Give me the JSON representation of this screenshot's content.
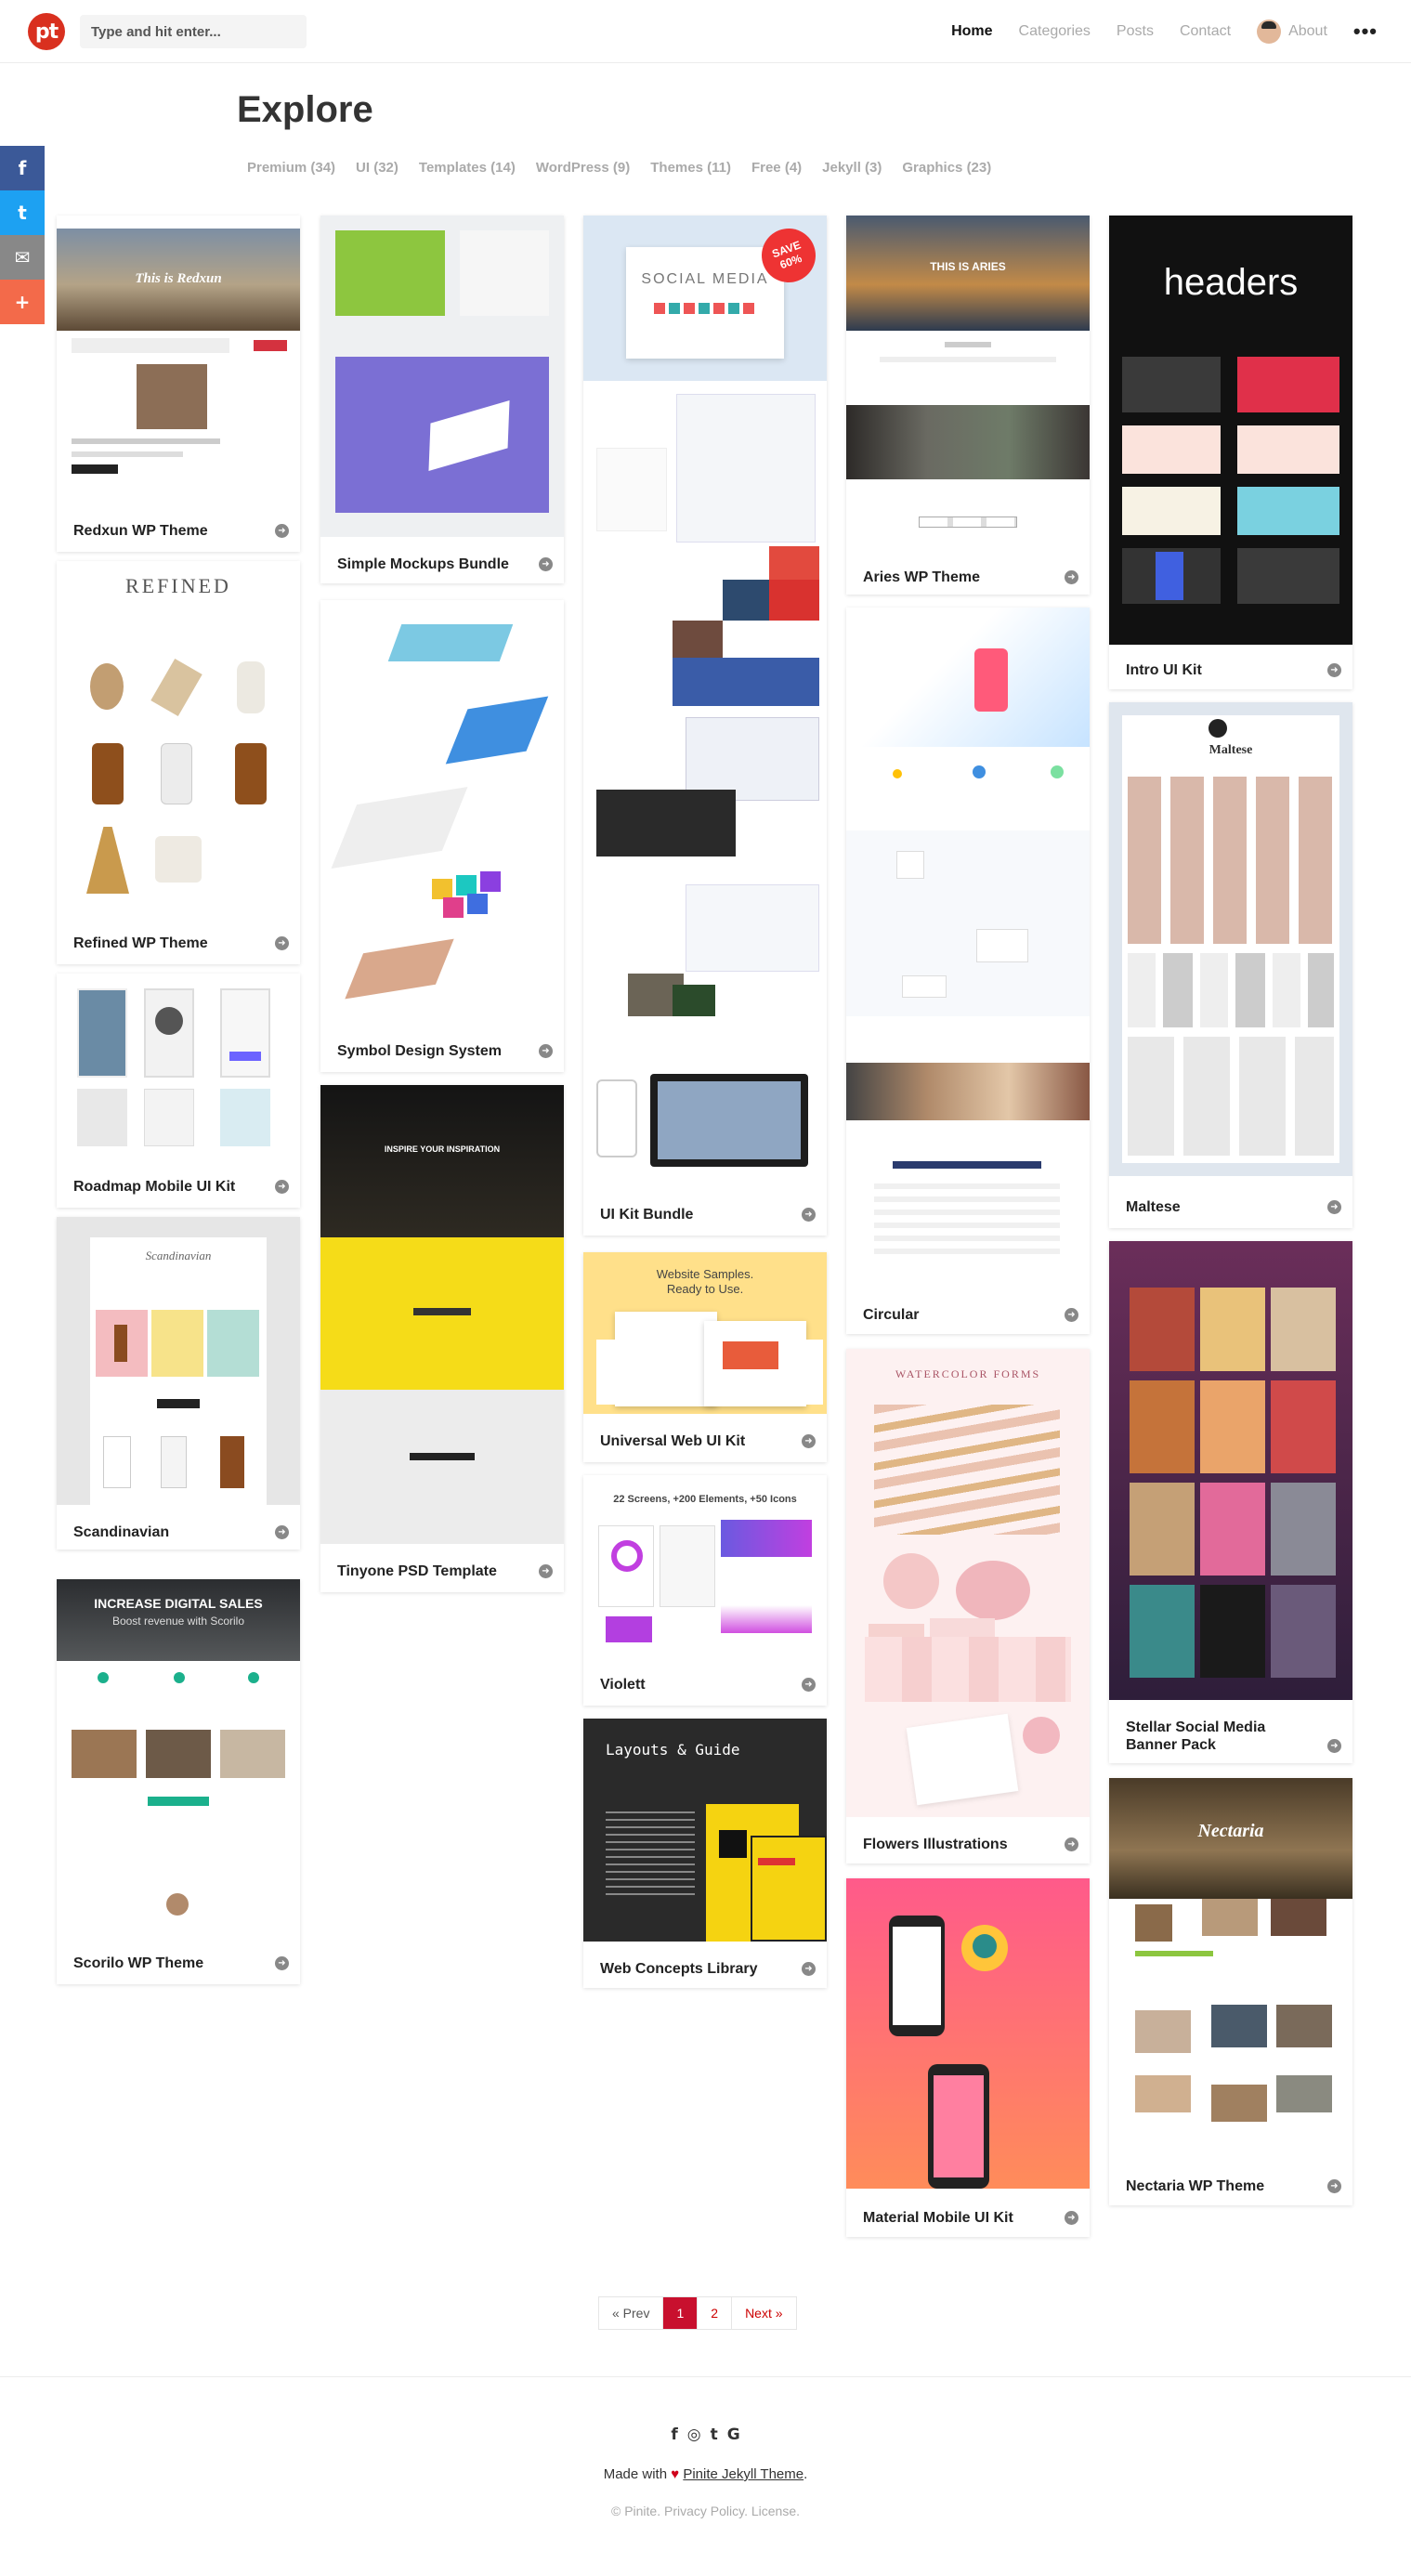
{
  "header": {
    "logo_text": "pt",
    "search_placeholder": "Type and hit enter...",
    "nav": [
      "Home",
      "Categories",
      "Posts",
      "Contact",
      "About"
    ],
    "more": "•••"
  },
  "share": [
    {
      "icon": "facebook-icon",
      "glyph": "f",
      "color": "#3b5998"
    },
    {
      "icon": "twitter-icon",
      "glyph": "t",
      "color": "#1da1f2"
    },
    {
      "icon": "mail-icon",
      "glyph": "✉",
      "color": "#888"
    },
    {
      "icon": "plus-icon",
      "glyph": "+",
      "color": "#f36a4a"
    }
  ],
  "page_title": "Explore",
  "categories": [
    "Premium (34)",
    "UI (32)",
    "Templates (14)",
    "WordPress (9)",
    "Themes (11)",
    "Free (4)",
    "Jekyll (3)",
    "Graphics (23)"
  ],
  "posts": [
    "Redxun WP Theme",
    "Refined WP Theme",
    "Roadmap Mobile UI Kit",
    "Scandinavian",
    "Scorilo WP Theme",
    "Simple Mockups Bundle",
    "Symbol Design System",
    "Tinyone PSD Template",
    "UI Kit Bundle",
    "Universal Web UI Kit",
    "Violett",
    "Web Concepts Library",
    "Aries WP Theme",
    "Circular",
    "Flowers Illustrations",
    "Material Mobile UI Kit",
    "Intro UI Kit",
    "Maltese",
    "Stellar Social Media Banner Pack",
    "Nectaria WP Theme"
  ],
  "thumb_text": {
    "redxun": "This is Redxun",
    "refined": "REFINED",
    "scand": "Scandinavian",
    "scorilo_1": "INCREASE DIGITAL SALES",
    "scorilo_2": "Boost revenue with Scorilo",
    "tinyone": "INSPIRE YOUR INSPIRATION",
    "social": "SOCIAL MEDIA",
    "save": "SAVE 60%",
    "universal_1": "Website Samples.",
    "universal_2": "Ready to Use.",
    "violett": "22 Screens, +200 Elements, +50 Icons",
    "layouts": "Layouts & Guide",
    "aries": "THIS IS ARIES",
    "watercolor": "WATERCOLOR FORMS",
    "headers": "headers",
    "maltese": "Maltese",
    "nectaria": "Nectaria"
  },
  "pagination": {
    "prev": "« Prev",
    "current": "1",
    "page2": "2",
    "next": "Next »"
  },
  "footer": {
    "icons": [
      "f",
      "◎",
      "t",
      "G"
    ],
    "made_with": "Made with",
    "theme_link": "Pinite Jekyll Theme",
    "copyright": "© Pinite. Privacy Policy. License."
  }
}
